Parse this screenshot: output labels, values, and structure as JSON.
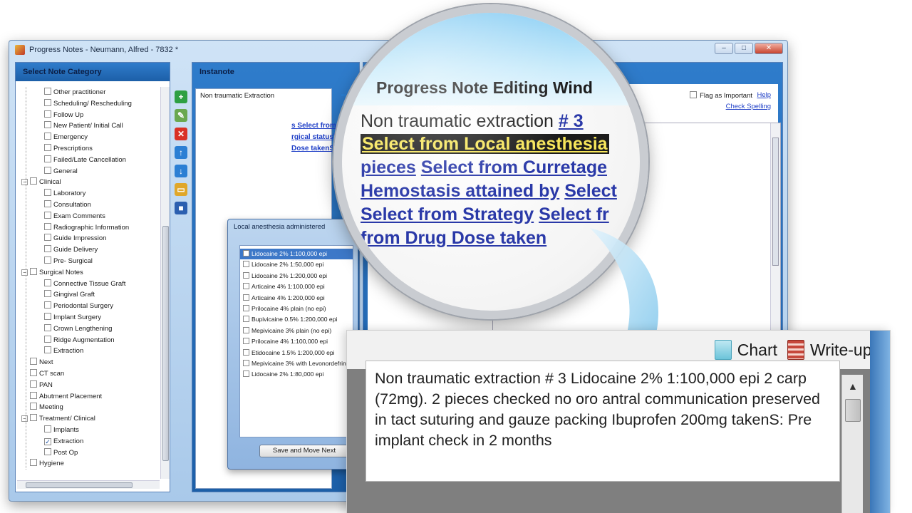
{
  "window": {
    "title": "Progress Notes - Neumann, Alfred - 7832 *",
    "controls": {
      "minimize": "–",
      "maximize": "□",
      "close": "✕"
    }
  },
  "category_panel": {
    "header": "Select Note Category",
    "tree": [
      {
        "label": "Other practitioner",
        "level": 2,
        "checked": false
      },
      {
        "label": "Scheduling/ Rescheduling",
        "level": 2,
        "checked": false
      },
      {
        "label": "Follow Up",
        "level": 2,
        "checked": false
      },
      {
        "label": "New Patient/ Initial Call",
        "level": 2,
        "checked": false
      },
      {
        "label": "Emergency",
        "level": 2,
        "checked": false
      },
      {
        "label": "Prescriptions",
        "level": 2,
        "checked": false
      },
      {
        "label": "Failed/Late Cancellation",
        "level": 2,
        "checked": false
      },
      {
        "label": "General",
        "level": 2,
        "checked": false
      },
      {
        "label": "Clinical",
        "level": 1,
        "checked": false,
        "expander": "−"
      },
      {
        "label": "Laboratory",
        "level": 2,
        "checked": false
      },
      {
        "label": "Consultation",
        "level": 2,
        "checked": false
      },
      {
        "label": "Exam Comments",
        "level": 2,
        "checked": false
      },
      {
        "label": "Radiographic Information",
        "level": 2,
        "checked": false
      },
      {
        "label": "Guide Impression",
        "level": 2,
        "checked": false
      },
      {
        "label": "Guide Delivery",
        "level": 2,
        "checked": false
      },
      {
        "label": "Pre- Surgical",
        "level": 2,
        "checked": false
      },
      {
        "label": "Surgical Notes",
        "level": 1,
        "checked": false,
        "expander": "−"
      },
      {
        "label": "Connective Tissue Graft",
        "level": 2,
        "checked": false
      },
      {
        "label": "Gingival Graft",
        "level": 2,
        "checked": false
      },
      {
        "label": "Periodontal Surgery",
        "level": 2,
        "checked": false
      },
      {
        "label": "Implant Surgery",
        "level": 2,
        "checked": false
      },
      {
        "label": "Crown Lengthening",
        "level": 2,
        "checked": false
      },
      {
        "label": "Ridge Augmentation",
        "level": 2,
        "checked": false
      },
      {
        "label": "Extraction",
        "level": 2,
        "checked": false
      },
      {
        "label": "Next",
        "level": 1,
        "checked": false
      },
      {
        "label": "CT scan",
        "level": 1,
        "checked": false
      },
      {
        "label": "PAN",
        "level": 1,
        "checked": false
      },
      {
        "label": "Abutment Placement",
        "level": 1,
        "checked": false
      },
      {
        "label": "Meeting",
        "level": 1,
        "checked": false
      },
      {
        "label": "Treatment/ Clinical",
        "level": 1,
        "checked": false,
        "expander": "−"
      },
      {
        "label": "Implants",
        "level": 2,
        "checked": false
      },
      {
        "label": "Extraction",
        "level": 2,
        "checked": true
      },
      {
        "label": "Post Op",
        "level": 2,
        "checked": false
      },
      {
        "label": "Hygiene",
        "level": 1,
        "checked": false
      }
    ]
  },
  "toolbar": {
    "icons": [
      {
        "name": "add-icon",
        "glyph": "+",
        "color": "#2ea043"
      },
      {
        "name": "edit-icon",
        "glyph": "✎",
        "color": "#6aa84f"
      },
      {
        "name": "delete-icon",
        "glyph": "✕",
        "color": "#d93025"
      },
      {
        "name": "move-up-icon",
        "glyph": "↑",
        "color": "#2b7fd4"
      },
      {
        "name": "move-down-icon",
        "glyph": "↓",
        "color": "#2b7fd4"
      },
      {
        "name": "folder-icon",
        "glyph": "▭",
        "color": "#e0a72a"
      },
      {
        "name": "save-icon",
        "glyph": "■",
        "color": "#2b5fb0"
      }
    ]
  },
  "instanote": {
    "header": "Instanote",
    "items": [
      "Non traumatic Extraction"
    ]
  },
  "right_panel": {
    "flag_label": "Flag as Important",
    "help": "Help",
    "check_spelling": "Check Spelling",
    "small_links": [
      "s  Select from number of",
      "rgical status) Select from",
      "Dose takenSelect from"
    ]
  },
  "popup": {
    "title": "Local anesthesia administered",
    "options": [
      "Lidocaine 2% 1:100,000 epi",
      "Lidocaine 2% 1:50,000 epi",
      "Lidocaine 2% 1:200,000 epi",
      "Articaine 4% 1:100,000 epi",
      "Articaine 4% 1:200,000 epi",
      "Prilocaine 4% plain (no epi)",
      "Bupivicaine 0.5% 1:200,000 epi",
      "Mepivicaine 3% plain (no epi)",
      "Prilocaine 4% 1:100,000 epi",
      "Etidocaine 1.5% 1:200,000 epi",
      "Mepivicaine 3% with Levonordefrin",
      "Lidocaine 2% 1:80,000 epi"
    ],
    "selected_index": 0,
    "button": "Save and Move Next"
  },
  "lens": {
    "title": "Progress Note Editing Wind",
    "line1_plain": "Non traumatic extraction ",
    "line1_link": "# 3",
    "line2_highlight": "Select from Local anesthesia",
    "line3_link1": "pieces",
    "line3_link2": "Select from Curretage",
    "line4_link1": "Hemostasis attained by",
    "line4_link2": "Select",
    "line5_link1": "Select from Strategy",
    "line5_link2": "Select fr",
    "line6_link": "from Drug Dose taken"
  },
  "zoom": {
    "tab_chart": "Chart",
    "tab_writeups": "Write-ups",
    "note_text": "Non traumatic extraction # 3 Lidocaine 2% 1:100,000 epi 2 carp (72mg). 2 pieces checked no oro antral communication preserved in tact suturing and gauze packing Ibuprofen 200mg takenS: Pre implant check in 2 months"
  },
  "colors": {
    "panel_blue": "#2f7ccb",
    "link_blue": "#2a39a8",
    "highlight_yellow": "#f7e65a"
  }
}
